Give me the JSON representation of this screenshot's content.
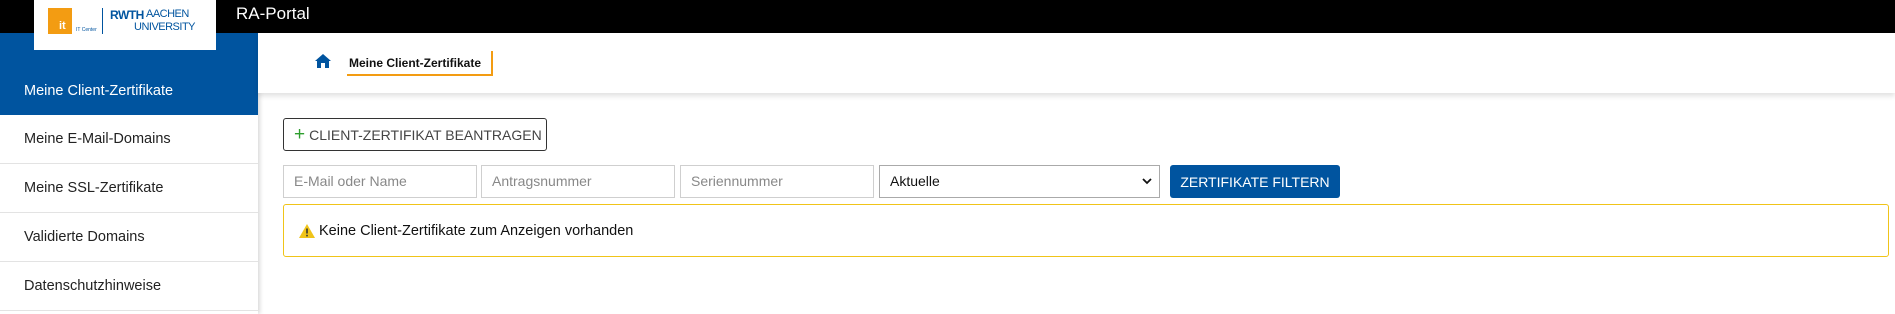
{
  "header": {
    "app_title": "RA-Portal",
    "logo": {
      "it": "it",
      "itcenter": "IT Center",
      "rwth": "RWTH",
      "aachen": "AACHEN",
      "university": "UNIVERSITY"
    }
  },
  "sidebar": {
    "items": [
      {
        "label": "Meine Client-Zertifikate",
        "active": true
      },
      {
        "label": "Meine E-Mail-Domains",
        "active": false
      },
      {
        "label": "Meine SSL-Zertifikate",
        "active": false
      },
      {
        "label": "Validierte Domains",
        "active": false
      },
      {
        "label": "Datenschutzhinweise",
        "active": false
      }
    ]
  },
  "breadcrumb": {
    "home_icon": "home-icon",
    "current": "Meine Client-Zertifikate"
  },
  "actions": {
    "new_label": "CLIENT-ZERTIFIKAT BEANTRAGEN"
  },
  "filters": {
    "email_placeholder": "E-Mail oder Name",
    "request_placeholder": "Antragsnummer",
    "serial_placeholder": "Seriennummer",
    "status_selected": "Aktuelle",
    "filter_label": "ZERTIFIKATE FILTERN"
  },
  "alert": {
    "message": "Keine Client-Zertifikate zum Anzeigen vorhanden"
  },
  "colors": {
    "brand": "#00549f",
    "accent": "#f39c12",
    "warning_border": "#f0c419",
    "plus": "#2e9e2e"
  }
}
